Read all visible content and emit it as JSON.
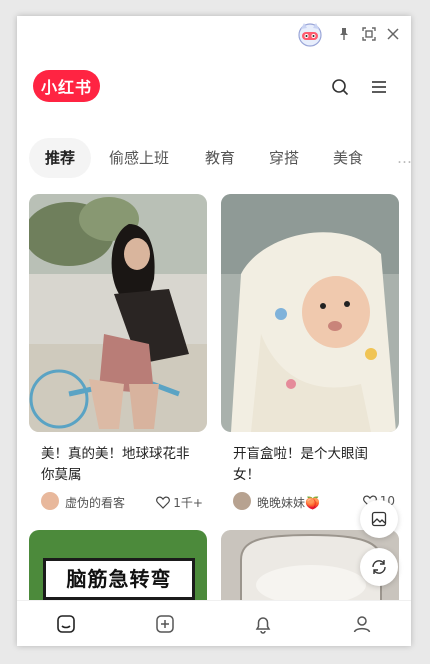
{
  "app": {
    "logo_text": "小红书"
  },
  "tabs": [
    {
      "label": "推荐",
      "active": true
    },
    {
      "label": "偷感上班"
    },
    {
      "label": "教育"
    },
    {
      "label": "穿搭"
    },
    {
      "label": "美食"
    }
  ],
  "feed": [
    {
      "title": "美！真的美！地球球花非你莫属",
      "author": "虚伪的看客",
      "likes": "1千+"
    },
    {
      "title": "开盲盒啦！是个大眼闺女！",
      "author": "晚晚妹妹🍑",
      "likes": "10"
    }
  ],
  "teaser": {
    "title": "脑筋急转弯"
  },
  "colors": {
    "brand": "#ff2442",
    "teaser_bg": "#4c8a3b"
  },
  "icons": {
    "titlebar": [
      "mascot-icon",
      "pin-icon",
      "expand-icon",
      "close-icon"
    ],
    "header": [
      "search-icon",
      "menu-icon"
    ],
    "float": [
      "image-icon",
      "refresh-icon"
    ],
    "nav": [
      "home-icon",
      "publish-icon",
      "bell-icon",
      "profile-icon"
    ]
  }
}
